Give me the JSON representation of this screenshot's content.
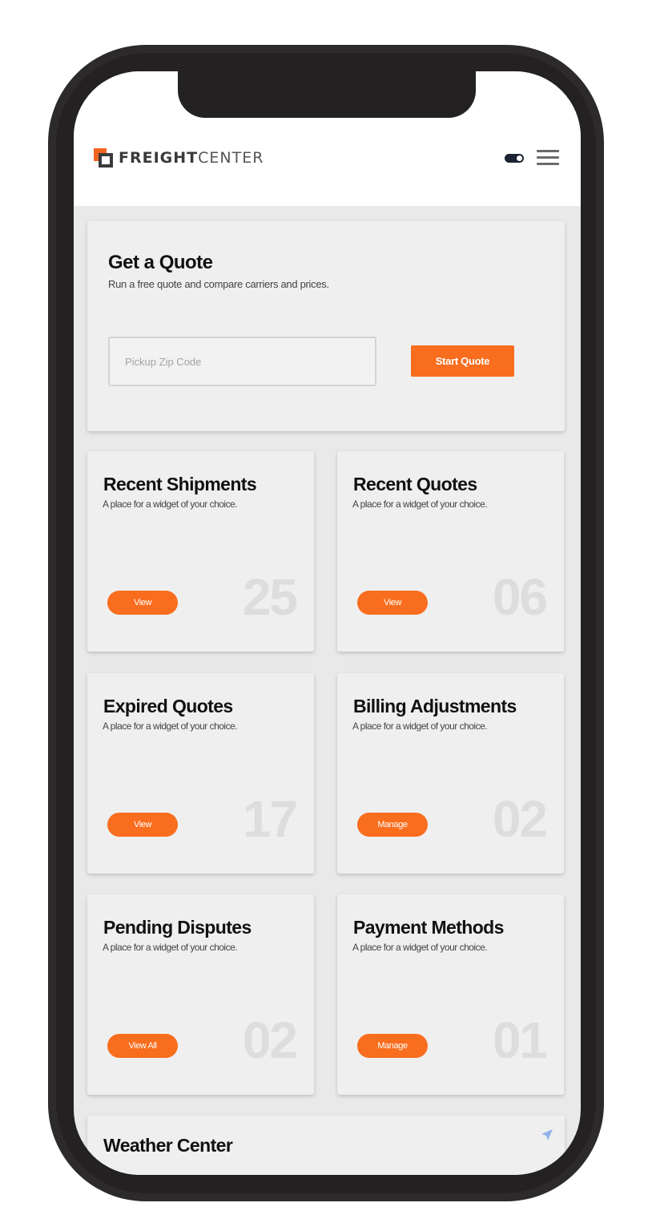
{
  "brand": {
    "name_bold": "FREIGHT",
    "name_light": "CENTER",
    "accent": "#f96d1e"
  },
  "quote": {
    "title": "Get a Quote",
    "subtitle": "Run a free quote and compare carriers and prices.",
    "zip_placeholder": "Pickup Zip Code",
    "button_label": "Start Quote"
  },
  "widgets": [
    {
      "title": "Recent Shipments",
      "subtitle": "A place for a widget of your choice.",
      "button": "View",
      "count": "25"
    },
    {
      "title": "Recent Quotes",
      "subtitle": "A place for a widget of your choice.",
      "button": "View",
      "count": "06"
    },
    {
      "title": "Expired Quotes",
      "subtitle": "A place for a widget of your choice.",
      "button": "View",
      "count": "17"
    },
    {
      "title": "Billing Adjustments",
      "subtitle": "A place for a widget of your choice.",
      "button": "Manage",
      "count": "02"
    },
    {
      "title": "Pending Disputes",
      "subtitle": "A place for a widget of your choice.",
      "button": "View All",
      "count": "02"
    },
    {
      "title": "Payment Methods",
      "subtitle": "A place for a widget of your choice.",
      "button": "Manage",
      "count": "01"
    }
  ],
  "weather": {
    "title": "Weather Center"
  },
  "icons": {
    "header_toggle": "toggle-icon",
    "header_menu": "hamburger-menu-icon",
    "weather": "location-arrow-icon"
  }
}
